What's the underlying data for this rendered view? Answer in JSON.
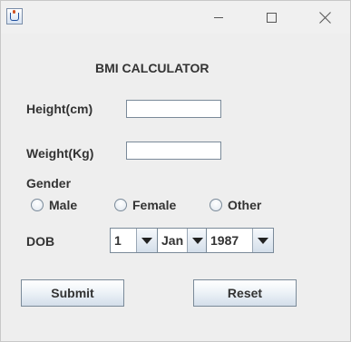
{
  "window": {
    "icon": "java-cup-icon",
    "controls": [
      "minimize-icon",
      "maximize-icon",
      "close-icon"
    ]
  },
  "form": {
    "title": "BMI CALCULATOR",
    "height_label": "Height(cm)",
    "height_value": "",
    "weight_label": "Weight(Kg)",
    "weight_value": "",
    "gender_label": "Gender",
    "gender_options": [
      "Male",
      "Female",
      "Other"
    ],
    "dob_label": "DOB",
    "dob_day": "1",
    "dob_month": "Jan",
    "dob_year": "1987",
    "submit_label": "Submit",
    "reset_label": "Reset"
  }
}
